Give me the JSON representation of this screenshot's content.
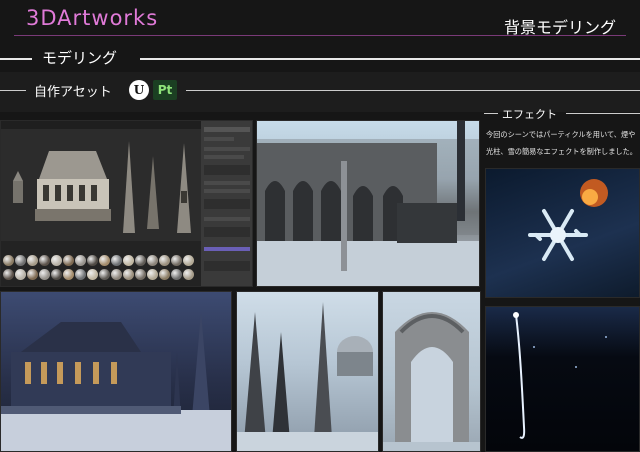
{
  "header": {
    "brand": "3DArtworks",
    "page_title": "背景モデリング"
  },
  "section": {
    "title": "モデリング"
  },
  "subsection": {
    "title": "自作アセット",
    "logos": [
      "ue-logo",
      "pt-logo"
    ],
    "pt_logo_text": "Pt"
  },
  "effects": {
    "title": "エフェクト",
    "description": "今回のシーンではパーティクルを用いて、煙や光柱、雪の簡易なエフェクトを制作しました。"
  },
  "colors": {
    "brand": "#e07ad8",
    "background": "#161616"
  },
  "images": [
    "editor-screenshot",
    "ruins-scene",
    "snowflake-effect",
    "light-trail-effect",
    "cathedral-night",
    "spires-scene",
    "arch-scene"
  ]
}
